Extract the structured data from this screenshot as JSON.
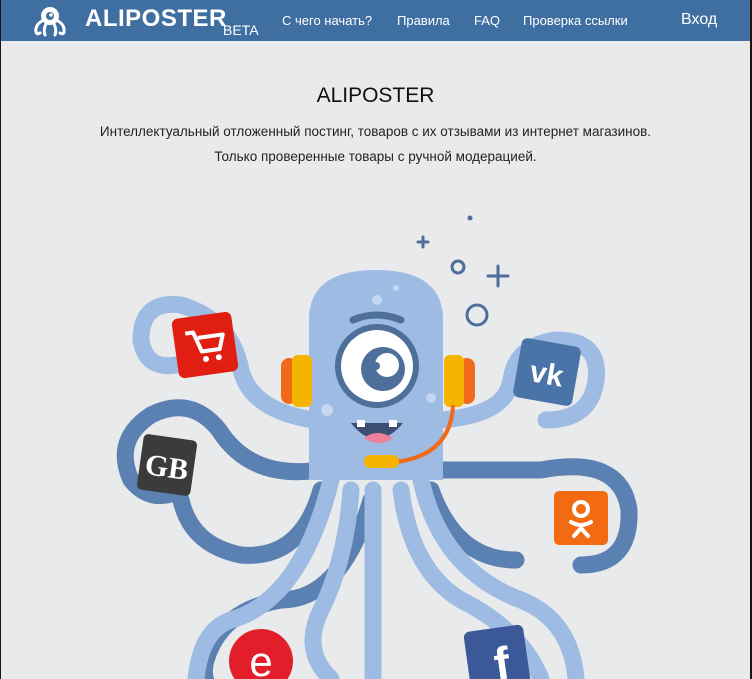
{
  "brand": {
    "name": "ALIPOSTER",
    "badge": "BETA"
  },
  "nav": {
    "items": [
      "С чего начать?",
      "Правила",
      "FAQ",
      "Проверка ссылки"
    ],
    "login": "Вход"
  },
  "hero": {
    "title": "ALIPOSTER",
    "subtitle_line1": "Интеллектуальный отложенный постинг, товаров с их отзывами из интернет магазинов.",
    "subtitle_line2": "Только проверенные товары с ручной модерацией."
  },
  "icons": {
    "badges": [
      "shopping-cart-icon",
      "gb-logo-icon",
      "vk-icon",
      "odnoklassniki-icon",
      "e-logo-icon",
      "facebook-icon"
    ],
    "logo": "octopus-logo-icon"
  },
  "colors": {
    "navbar": "#3f6fa0",
    "background": "#e9eaec",
    "octopus_light": "#9dbbe3",
    "octopus_dark": "#5b80b2",
    "headset": "#f08020"
  }
}
